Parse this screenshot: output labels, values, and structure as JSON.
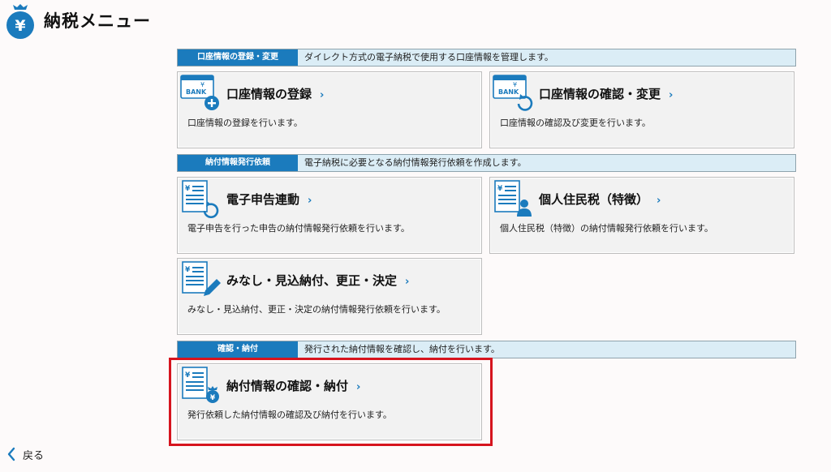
{
  "header": {
    "title": "納税メニュー",
    "icon": "yen-bag-icon"
  },
  "sections": [
    {
      "label": "口座情報の登録・変更",
      "description": "ダイレクト方式の電子納税で使用する口座情報を管理します。",
      "cards": [
        {
          "title": "口座情報の登録",
          "desc": "口座情報の登録を行います。",
          "icon": "bank-card-add-icon"
        },
        {
          "title": "口座情報の確認・変更",
          "desc": "口座情報の確認及び変更を行います。",
          "icon": "bank-card-refresh-icon"
        }
      ]
    },
    {
      "label": "納付情報発行依頼",
      "description": "電子納税に必要となる納付情報発行依頼を作成します。",
      "cards": [
        {
          "title": "電子申告連動",
          "desc": "電子申告を行った申告の納付情報発行依頼を行います。",
          "icon": "document-sync-icon"
        },
        {
          "title": "個人住民税（特徴）",
          "desc": "個人住民税（特徴）の納付情報発行依頼を行います。",
          "icon": "document-person-icon"
        },
        {
          "title": "みなし・見込納付、更正・決定",
          "desc": "みなし・見込納付、更正・決定の納付情報発行依頼を行います。",
          "icon": "document-pen-icon"
        }
      ]
    },
    {
      "label": "確認・納付",
      "description": "発行された納付情報を確認し、納付を行います。",
      "cards": [
        {
          "title": "納付情報の確認・納付",
          "desc": "発行依頼した納付情報の確認及び納付を行います。",
          "icon": "document-yen-bag-icon"
        }
      ]
    }
  ],
  "chevron": "›",
  "back": {
    "label": "戻る",
    "icon": "chevron-left-icon"
  },
  "colors": {
    "accent": "#1b7bbd",
    "section_bg": "#dbedf6",
    "card_bg": "#f2f2f2",
    "highlight": "#d6141e"
  }
}
